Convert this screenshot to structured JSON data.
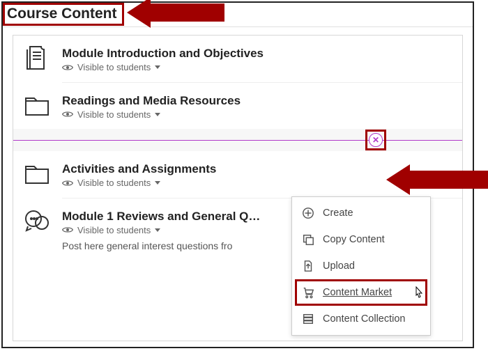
{
  "header": {
    "title": "Course Content"
  },
  "items": [
    {
      "title": "Module Introduction and Objectives",
      "visibility": "Visible to students"
    },
    {
      "title": "Readings and Media Resources",
      "visibility": "Visible to students"
    },
    {
      "title": "Activities and Assignments",
      "visibility": "Visible to students"
    },
    {
      "title": "Module 1 Reviews and General Q…",
      "visibility": "Visible to students",
      "desc": "Post here general interest questions fro"
    }
  ],
  "insert": {
    "glyph": "✕"
  },
  "menu": {
    "items": [
      {
        "name": "create",
        "label": "Create"
      },
      {
        "name": "copy",
        "label": "Copy Content"
      },
      {
        "name": "upload",
        "label": "Upload"
      },
      {
        "name": "market",
        "label": "Content Market"
      },
      {
        "name": "coll",
        "label": "Content Collection"
      }
    ]
  },
  "layout": {
    "insertBtnLeft": 520,
    "menuLeft": 418,
    "menuTop": 282
  }
}
